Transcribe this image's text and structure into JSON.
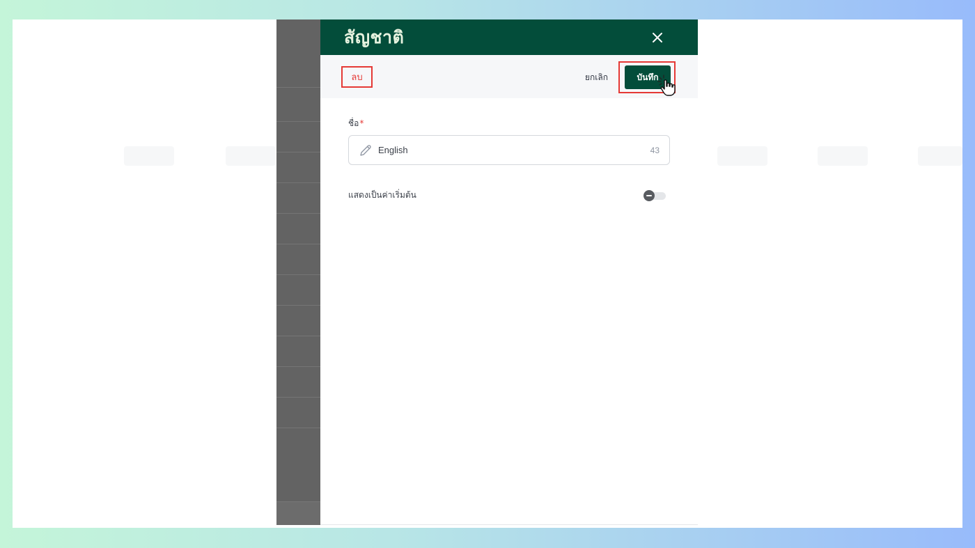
{
  "drawer": {
    "title": "สัญชาติ",
    "close_icon": "close-icon"
  },
  "actions": {
    "delete_label": "ลบ",
    "cancel_label": "ยกเลิก",
    "save_label": "บันทึก"
  },
  "form": {
    "name_label": "ชื่อ",
    "required_mark": "*",
    "name_value": "English",
    "name_char_count": "43",
    "name_icon": "pencil-icon",
    "default_label": "แสดงเป็นค่าเริ่มต้น",
    "default_on": false
  },
  "colors": {
    "header_bg": "#034d3a",
    "highlight": "#e53935"
  }
}
